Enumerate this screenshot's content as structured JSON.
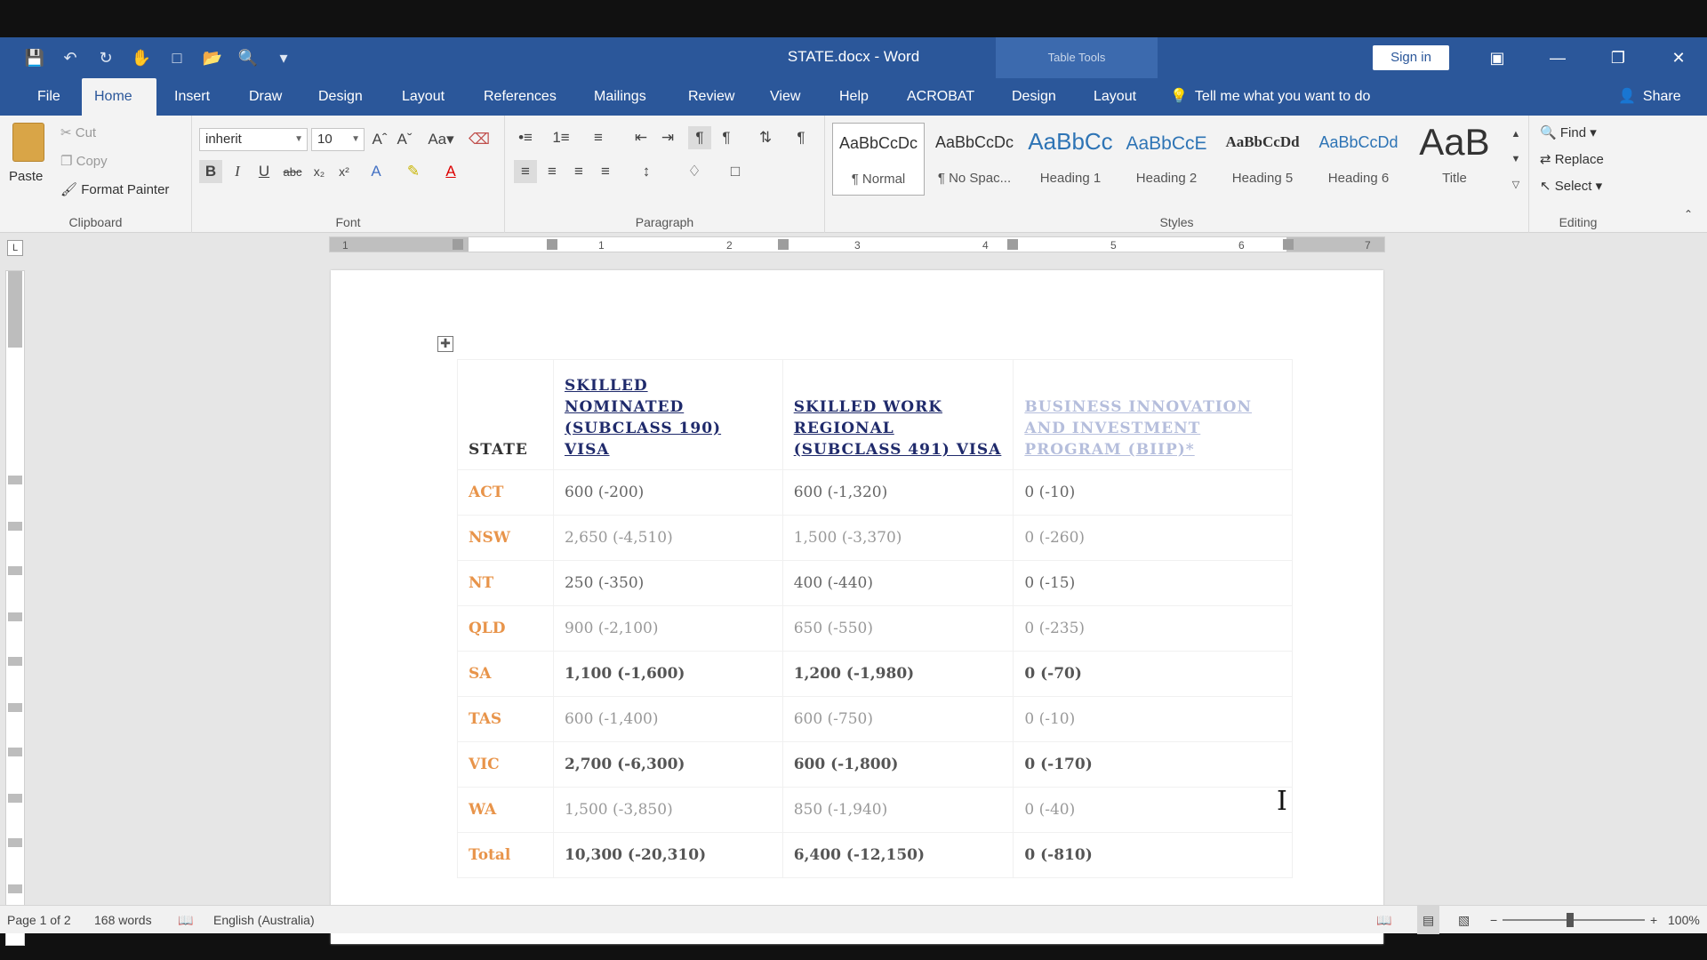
{
  "titlebar": {
    "document_name": "STATE.docx",
    "separator": "-",
    "app_name": "Word",
    "contextual_group": "Table Tools",
    "sign_in": "Sign in"
  },
  "tabs": [
    "File",
    "Home",
    "Insert",
    "Draw",
    "Design",
    "Layout",
    "References",
    "Mailings",
    "Review",
    "View",
    "Help",
    "ACROBAT",
    "Design",
    "Layout"
  ],
  "active_tab": "Home",
  "tell_me": "Tell me what you want to do",
  "share": "Share",
  "ribbon": {
    "clipboard": {
      "label": "Clipboard",
      "paste": "Paste",
      "cut": "Cut",
      "copy": "Copy",
      "format_painter": "Format Painter"
    },
    "font": {
      "label": "Font",
      "family": "inherit",
      "size": "10"
    },
    "paragraph": {
      "label": "Paragraph"
    },
    "styles": {
      "label": "Styles",
      "items": [
        {
          "sample": "AaBbCcDc",
          "name": "¶ Normal"
        },
        {
          "sample": "AaBbCcDc",
          "name": "¶ No Spac..."
        },
        {
          "sample": "AaBbCc",
          "name": "Heading 1"
        },
        {
          "sample": "AaBbCcE",
          "name": "Heading 2"
        },
        {
          "sample": "AaBbCcDd",
          "name": "Heading 5"
        },
        {
          "sample": "AaBbCcDd",
          "name": "Heading 6"
        },
        {
          "sample": "AaB",
          "name": "Title"
        }
      ]
    },
    "editing": {
      "label": "Editing",
      "find": "Find",
      "replace": "Replace",
      "select": "Select"
    }
  },
  "ruler": [
    "1",
    "1",
    "2",
    "3",
    "4",
    "5",
    "6",
    "7"
  ],
  "table": {
    "headers": [
      "STATE",
      "SKILLED NOMINATED (SUBCLASS 190) VISA",
      "SKILLED WORK REGIONAL (SUBCLASS 491) VISA",
      "BUSINESS INNOVATION AND INVESTMENT PROGRAM (BIIP)*"
    ],
    "rows": [
      {
        "state": "ACT",
        "s190": "600 (-200)",
        "s491": "600 (-1,320)",
        "biip": "0 (-10)"
      },
      {
        "state": "NSW",
        "s190": "2,650 (-4,510)",
        "s491": "1,500 (-3,370)",
        "biip": "0 (-260)"
      },
      {
        "state": "NT",
        "s190": "250 (-350)",
        "s491": "400 (-440)",
        "biip": "0 (-15)"
      },
      {
        "state": "QLD",
        "s190": "900 (-2,100)",
        "s491": "650 (-550)",
        "biip": "0 (-235)"
      },
      {
        "state": "SA",
        "s190": "1,100 (-1,600)",
        "s491": "1,200 (-1,980)",
        "biip": "0 (-70)"
      },
      {
        "state": "TAS",
        "s190": "600 (-1,400)",
        "s491": "600 (-750)",
        "biip": "0 (-10)"
      },
      {
        "state": "VIC",
        "s190": "2,700 (-6,300)",
        "s491": "600 (-1,800)",
        "biip": "0 (-170)"
      },
      {
        "state": "WA",
        "s190": "1,500 (-3,850)",
        "s491": "850 (-1,940)",
        "biip": "0 (-40)"
      },
      {
        "state": "Total",
        "s190": "10,300 (-20,310)",
        "s491": "6,400 (-12,150)",
        "biip": "0 (-810)"
      }
    ]
  },
  "status": {
    "page": "Page 1 of 2",
    "words": "168 words",
    "language": "English (Australia)",
    "zoom": "100%"
  },
  "colors": {
    "ribbon_blue": "#2b579a",
    "state_orange": "#e8944a",
    "header_navy": "#1f2a6b"
  }
}
